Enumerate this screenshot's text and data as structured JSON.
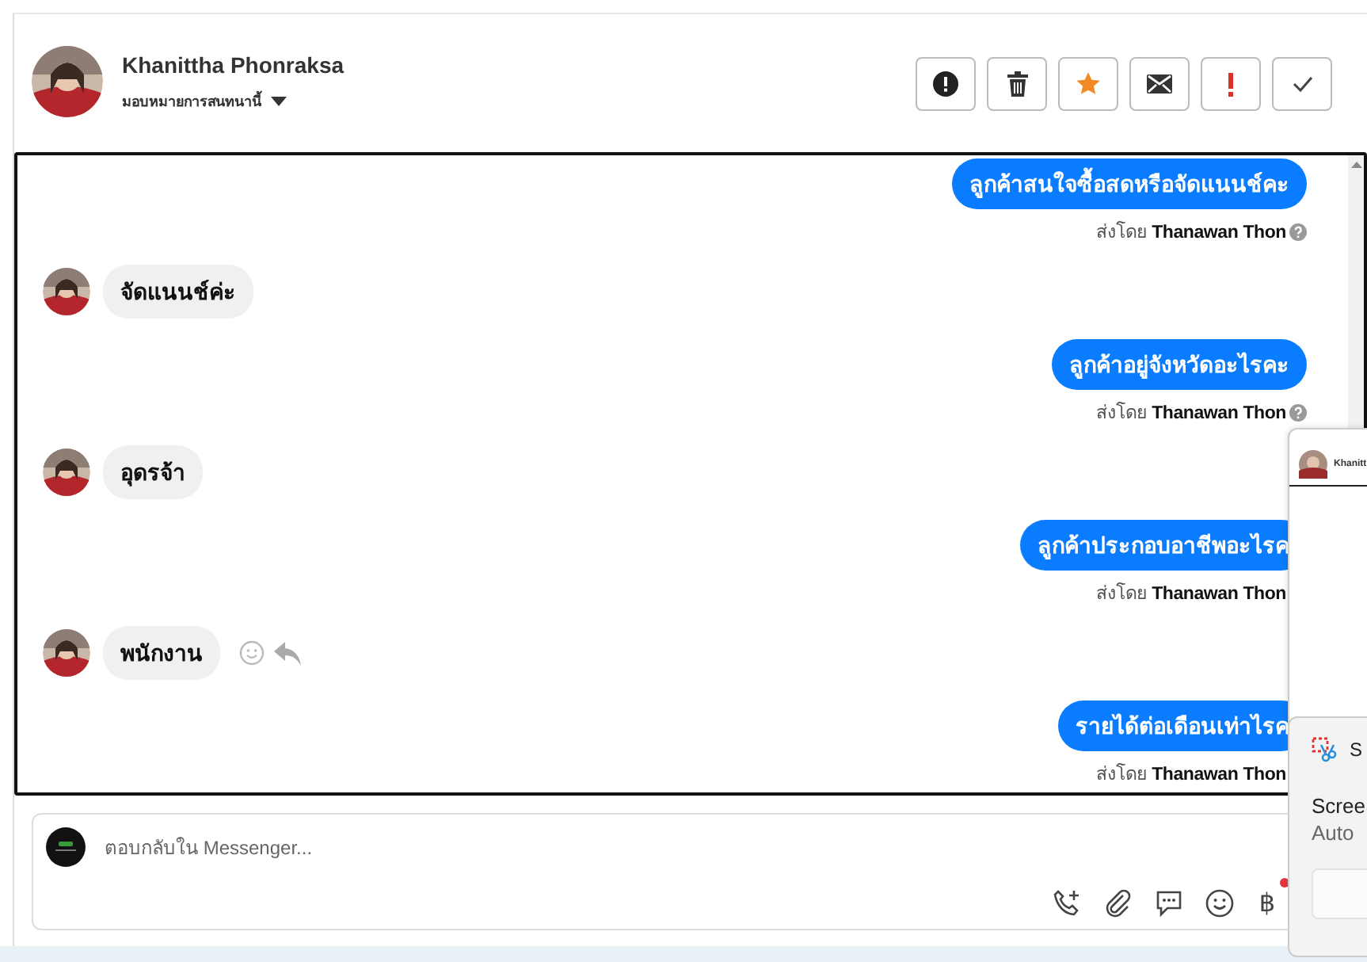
{
  "contact": {
    "name": "Khanittha Phonraksa",
    "assign_label": "มอบหมายการสนทนานี้"
  },
  "actions": [
    {
      "kind": "alert"
    },
    {
      "kind": "trash"
    },
    {
      "kind": "star"
    },
    {
      "kind": "mail"
    },
    {
      "kind": "important"
    },
    {
      "kind": "done"
    }
  ],
  "messages": [
    {
      "kind": "outgoing",
      "text": "ลูกค้าสนใจซื้อสดหรือจัดแนนช์คะ",
      "sent_by_label": "ส่งโดย",
      "sender": "Thanawan Thon",
      "info_icon": true
    },
    {
      "kind": "incoming",
      "text": "จัดแนนช์ค่ะ",
      "reactions": false
    },
    {
      "kind": "outgoing",
      "text": "ลูกค้าอยู่จังหวัดอะไรคะ",
      "sent_by_label": "ส่งโดย",
      "sender": "Thanawan Thon",
      "info_icon": true
    },
    {
      "kind": "incoming",
      "text": "อุดรจ้า",
      "reactions": false
    },
    {
      "kind": "outgoing",
      "text": "ลูกค้าประกอบอาชีพอะไรค",
      "sent_by_label": "ส่งโดย",
      "sender": "Thanawan Thon"
    },
    {
      "kind": "incoming",
      "text": "พนักงาน",
      "reactions": true
    },
    {
      "kind": "outgoing",
      "text": "รายได้ต่อเดือนเท่าไรค",
      "sent_by_label": "ส่งโดย",
      "sender": "Thanawan Thon"
    }
  ],
  "composer": {
    "placeholder": "ตอบกลับใน Messenger...",
    "tools": [
      {
        "kind": "call"
      },
      {
        "kind": "attach"
      },
      {
        "kind": "chat"
      },
      {
        "kind": "emoji"
      },
      {
        "kind": "currency",
        "text": "฿",
        "badge": true
      }
    ]
  },
  "preview": {
    "title": "Khanitt"
  },
  "notification": {
    "app": "S",
    "title": "Scree",
    "subtitle": "Auto"
  }
}
